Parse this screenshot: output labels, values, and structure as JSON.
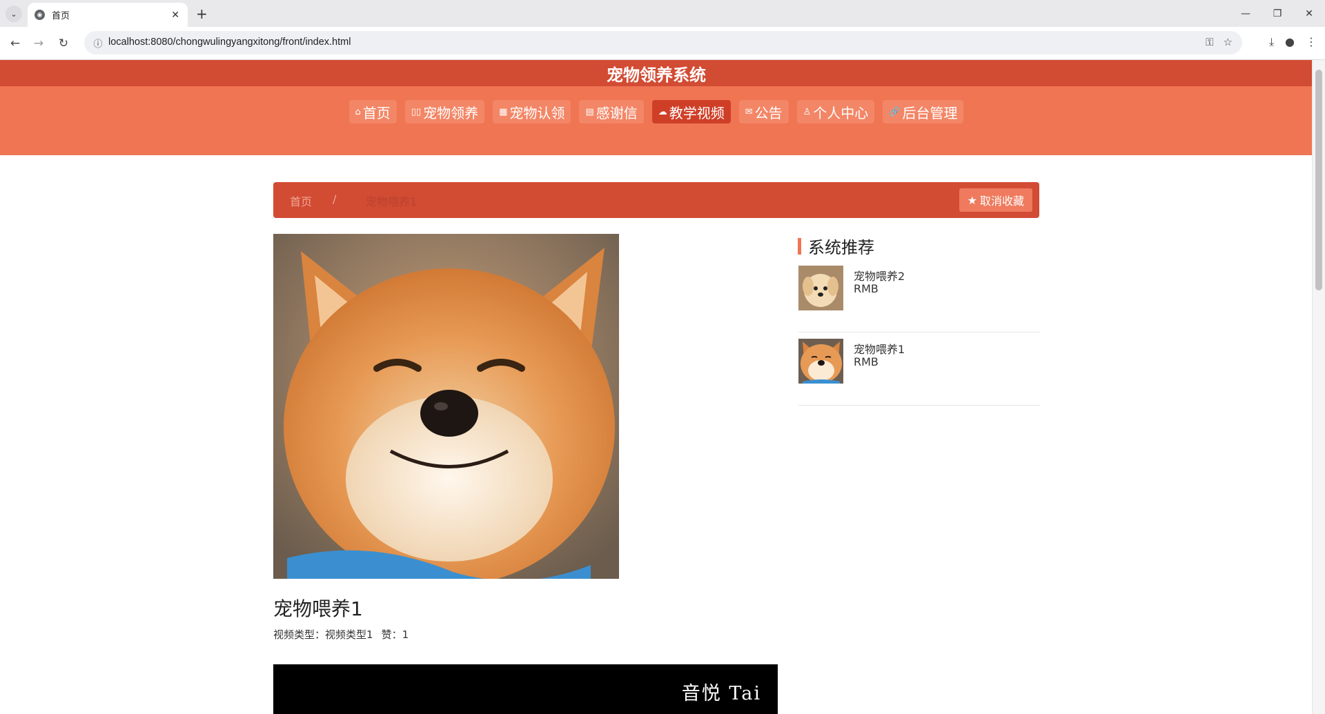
{
  "browser": {
    "tab_title": "首页",
    "url": "localhost:8080/chongwulingyangxitong/front/index.html"
  },
  "site": {
    "title": "宠物领养系统"
  },
  "nav": {
    "items": [
      {
        "label": "首页",
        "icon": "⌂",
        "icon_name": "home-icon"
      },
      {
        "label": "宠物领养",
        "icon": "▯▯",
        "icon_name": "pets-icon"
      },
      {
        "label": "宠物认领",
        "icon": "▦",
        "icon_name": "claim-icon"
      },
      {
        "label": "感谢信",
        "icon": "▤",
        "icon_name": "letter-icon"
      },
      {
        "label": "教学视频",
        "icon": "☁",
        "icon_name": "video-icon",
        "active": true
      },
      {
        "label": "公告",
        "icon": "✉",
        "icon_name": "notice-icon"
      },
      {
        "label": "个人中心",
        "icon": "♙",
        "icon_name": "user-icon"
      },
      {
        "label": "后台管理",
        "icon": "🔗",
        "icon_name": "link-icon"
      }
    ]
  },
  "breadcrumb": {
    "home": "首页",
    "separator": "/",
    "current": "宠物喂养1"
  },
  "favorite_button": {
    "label": "取消收藏"
  },
  "detail": {
    "title": "宠物喂养1",
    "type_label": "视频类型：",
    "type_value": "视频类型1",
    "like_label": "赞：",
    "like_value": "1"
  },
  "video": {
    "watermark": "音悦 Tai"
  },
  "recommend": {
    "title": "系统推荐",
    "items": [
      {
        "name": "宠物喂养2",
        "price": "RMB"
      },
      {
        "name": "宠物喂养1",
        "price": "RMB"
      }
    ]
  },
  "colors": {
    "header": "#d24b33",
    "nav": "#f07553",
    "active": "#cf3f28"
  }
}
